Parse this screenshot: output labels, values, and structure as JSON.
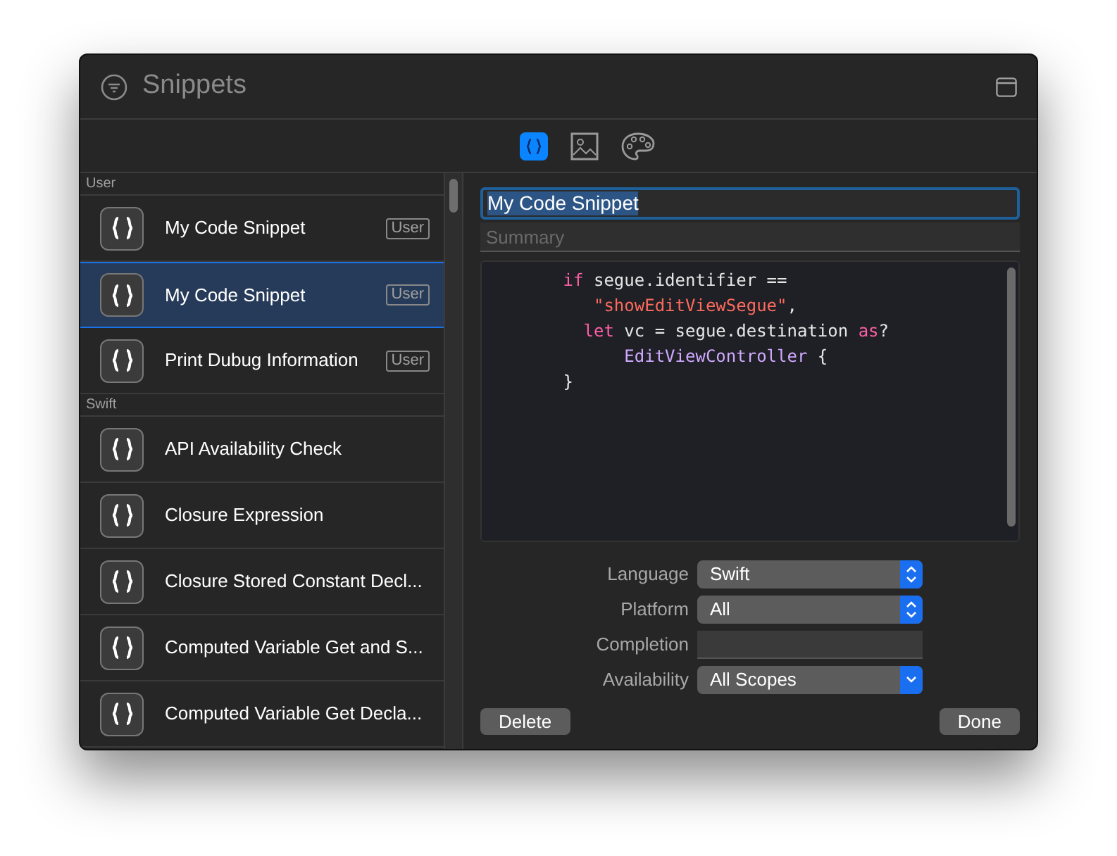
{
  "window": {
    "title": "Snippets"
  },
  "library_tabs": [
    {
      "kind": "code",
      "selected": true
    },
    {
      "kind": "image",
      "selected": false
    },
    {
      "kind": "color",
      "selected": false
    }
  ],
  "sections": [
    {
      "title": "User",
      "items": [
        {
          "name": "My Code Snippet",
          "badge": "User",
          "selected": false
        },
        {
          "name": "My Code Snippet",
          "badge": "User",
          "selected": true
        },
        {
          "name": "Print Dubug Information",
          "badge": "User",
          "selected": false
        }
      ]
    },
    {
      "title": "Swift",
      "items": [
        {
          "name": "API Availability Check",
          "selected": false
        },
        {
          "name": "Closure Expression",
          "selected": false
        },
        {
          "name": "Closure Stored Constant Decl...",
          "selected": false
        },
        {
          "name": "Computed Variable Get and S...",
          "selected": false
        },
        {
          "name": "Computed Variable Get Decla...",
          "selected": false
        }
      ]
    }
  ],
  "editor": {
    "title_field": {
      "value": "My Code Snippet"
    },
    "summary_field": {
      "placeholder": "Summary"
    },
    "code": [
      [
        {
          "text": "        if",
          "kind": "keyword"
        },
        {
          "text": " segue.identifier ==",
          "kind": "plain"
        }
      ],
      [
        {
          "text": "           \"showEditViewSegue\"",
          "kind": "string"
        },
        {
          "text": ",",
          "kind": "plain"
        }
      ],
      [
        {
          "text": "          let",
          "kind": "keyword"
        },
        {
          "text": " vc = segue.destination ",
          "kind": "plain"
        },
        {
          "text": "as",
          "kind": "keyword"
        },
        {
          "text": "?",
          "kind": "plain"
        }
      ],
      [
        {
          "text": "              EditViewController",
          "kind": "type"
        },
        {
          "text": " {",
          "kind": "plain"
        }
      ],
      [
        {
          "text": "        }",
          "kind": "plain"
        }
      ]
    ],
    "properties": [
      {
        "label": "Language",
        "kind": "stepper-popup",
        "value": "Swift"
      },
      {
        "label": "Platform",
        "kind": "stepper-popup",
        "value": "All"
      },
      {
        "label": "Completion",
        "kind": "text-field"
      },
      {
        "label": "Availability",
        "kind": "pulldown",
        "value": "All Scopes"
      }
    ],
    "buttons": [
      "Delete",
      "Done"
    ]
  }
}
